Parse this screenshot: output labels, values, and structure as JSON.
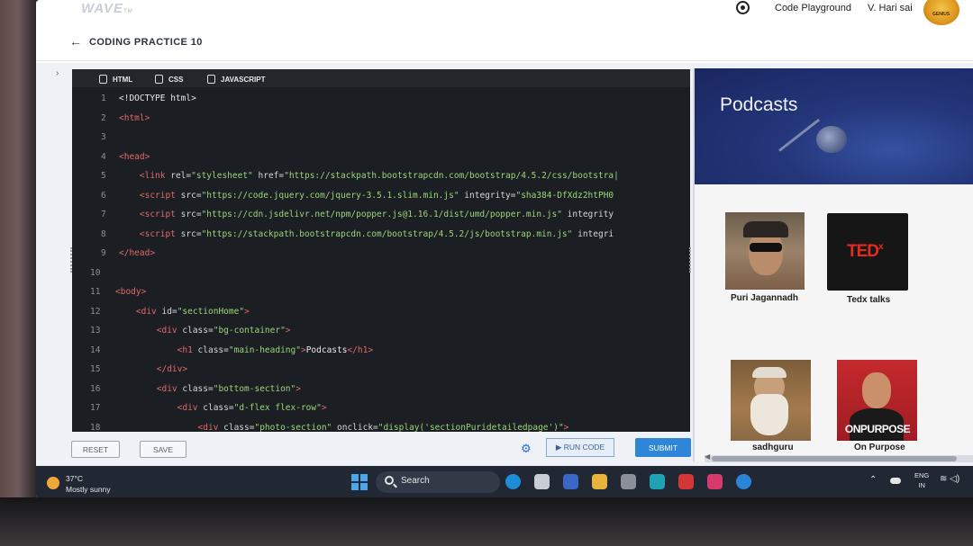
{
  "nav": {
    "logo": "WAVE",
    "logo_tm": "TM",
    "playground": "Code Playground",
    "user_name": "V. Hari sai",
    "badge_text": "GENIUS"
  },
  "page": {
    "back": "←",
    "title": "CODING PRACTICE 10"
  },
  "editor": {
    "tabs": [
      "HTML",
      "CSS",
      "JAVASCRIPT"
    ],
    "lines": [
      {
        "n": "1",
        "html": "<span class='p'>&lt;!DOCTYPE html&gt;</span>"
      },
      {
        "n": "2",
        "html": "<span class='t'>&lt;html&gt;</span>"
      },
      {
        "n": "3",
        "html": ""
      },
      {
        "n": "4",
        "html": "<span class='t'>&lt;head&gt;</span>"
      },
      {
        "n": "5",
        "html": "    <span class='t'>&lt;link</span> <span class='a'>rel=</span><span class='s'>\"stylesheet\"</span> <span class='a'>href=</span><span class='s'>\"https://stackpath.bootstrapcdn.com/bootstrap/4.5.2/css/bootstra|</span>"
      },
      {
        "n": "6",
        "html": "    <span class='t'>&lt;script</span> <span class='a'>src=</span><span class='s'>\"https://code.jquery.com/jquery-3.5.1.slim.min.js\"</span> <span class='a'>integrity=</span><span class='s'>\"sha384-DfXdz2htPH0</span>"
      },
      {
        "n": "7",
        "html": "    <span class='t'>&lt;script</span> <span class='a'>src=</span><span class='s'>\"https://cdn.jsdelivr.net/npm/popper.js@1.16.1/dist/umd/popper.min.js\"</span> <span class='a'>integrity</span>"
      },
      {
        "n": "8",
        "html": "    <span class='t'>&lt;script</span> <span class='a'>src=</span><span class='s'>\"https://stackpath.bootstrapcdn.com/bootstrap/4.5.2/js/bootstrap.min.js\"</span> <span class='a'>integri</span>"
      },
      {
        "n": "9",
        "html": "<span class='t'>&lt;/head&gt;</span>"
      },
      {
        "n": "10",
        "html": ""
      },
      {
        "n": "11",
        "html": "<span class='t'>&lt;body&gt;</span>"
      },
      {
        "n": "12",
        "html": "    <span class='t'>&lt;div</span> <span class='a'>id=</span><span class='s'>\"sectionHome\"</span><span class='t'>&gt;</span>"
      },
      {
        "n": "13",
        "html": "        <span class='t'>&lt;div</span> <span class='a'>class=</span><span class='s'>\"bg-container\"</span><span class='t'>&gt;</span>"
      },
      {
        "n": "14",
        "html": "            <span class='t'>&lt;h1</span> <span class='a'>class=</span><span class='s'>\"main-heading\"</span><span class='t'>&gt;</span><span class='p'>Podcasts</span><span class='t'>&lt;/h1&gt;</span>"
      },
      {
        "n": "15",
        "html": "        <span class='t'>&lt;/div&gt;</span>"
      },
      {
        "n": "16",
        "html": "        <span class='t'>&lt;div</span> <span class='a'>class=</span><span class='s'>\"bottom-section\"</span><span class='t'>&gt;</span>"
      },
      {
        "n": "17",
        "html": "            <span class='t'>&lt;div</span> <span class='a'>class=</span><span class='s'>\"d-flex flex-row\"</span><span class='t'>&gt;</span>"
      },
      {
        "n": "18",
        "html": "                <span class='t'>&lt;div</span> <span class='a'>class=</span><span class='s'>\"photo-section\"</span> <span class='a'>onclick=</span><span class='s'>\"display('sectionPuridetailedpage')\"</span><span class='t'>&gt;</span>"
      }
    ]
  },
  "actions": {
    "reset": "RESET",
    "save": "SAVE",
    "run": "▶ RUN CODE",
    "submit": "SUBMIT"
  },
  "preview": {
    "heading": "Podcasts",
    "cards": [
      {
        "caption": "Puri Jagannadh"
      },
      {
        "caption": "Tedx talks",
        "logo": "TED",
        "logo_x": "x"
      },
      {
        "caption": "sadhguru"
      },
      {
        "caption": "On Purpose",
        "logo": "ONPURPOSE"
      }
    ]
  },
  "taskbar": {
    "temp": "37°C",
    "weather": "Mostly sunny",
    "search": "Search",
    "lang_top": "ENG",
    "lang_bottom": "IN",
    "app_colors": [
      "#1f8cd8",
      "#c9ced6",
      "#3a66c6",
      "#e8b33d",
      "#8a8f9a",
      "#1fa2b3",
      "#d43535",
      "#d63a6a",
      "#2a85d9"
    ]
  }
}
